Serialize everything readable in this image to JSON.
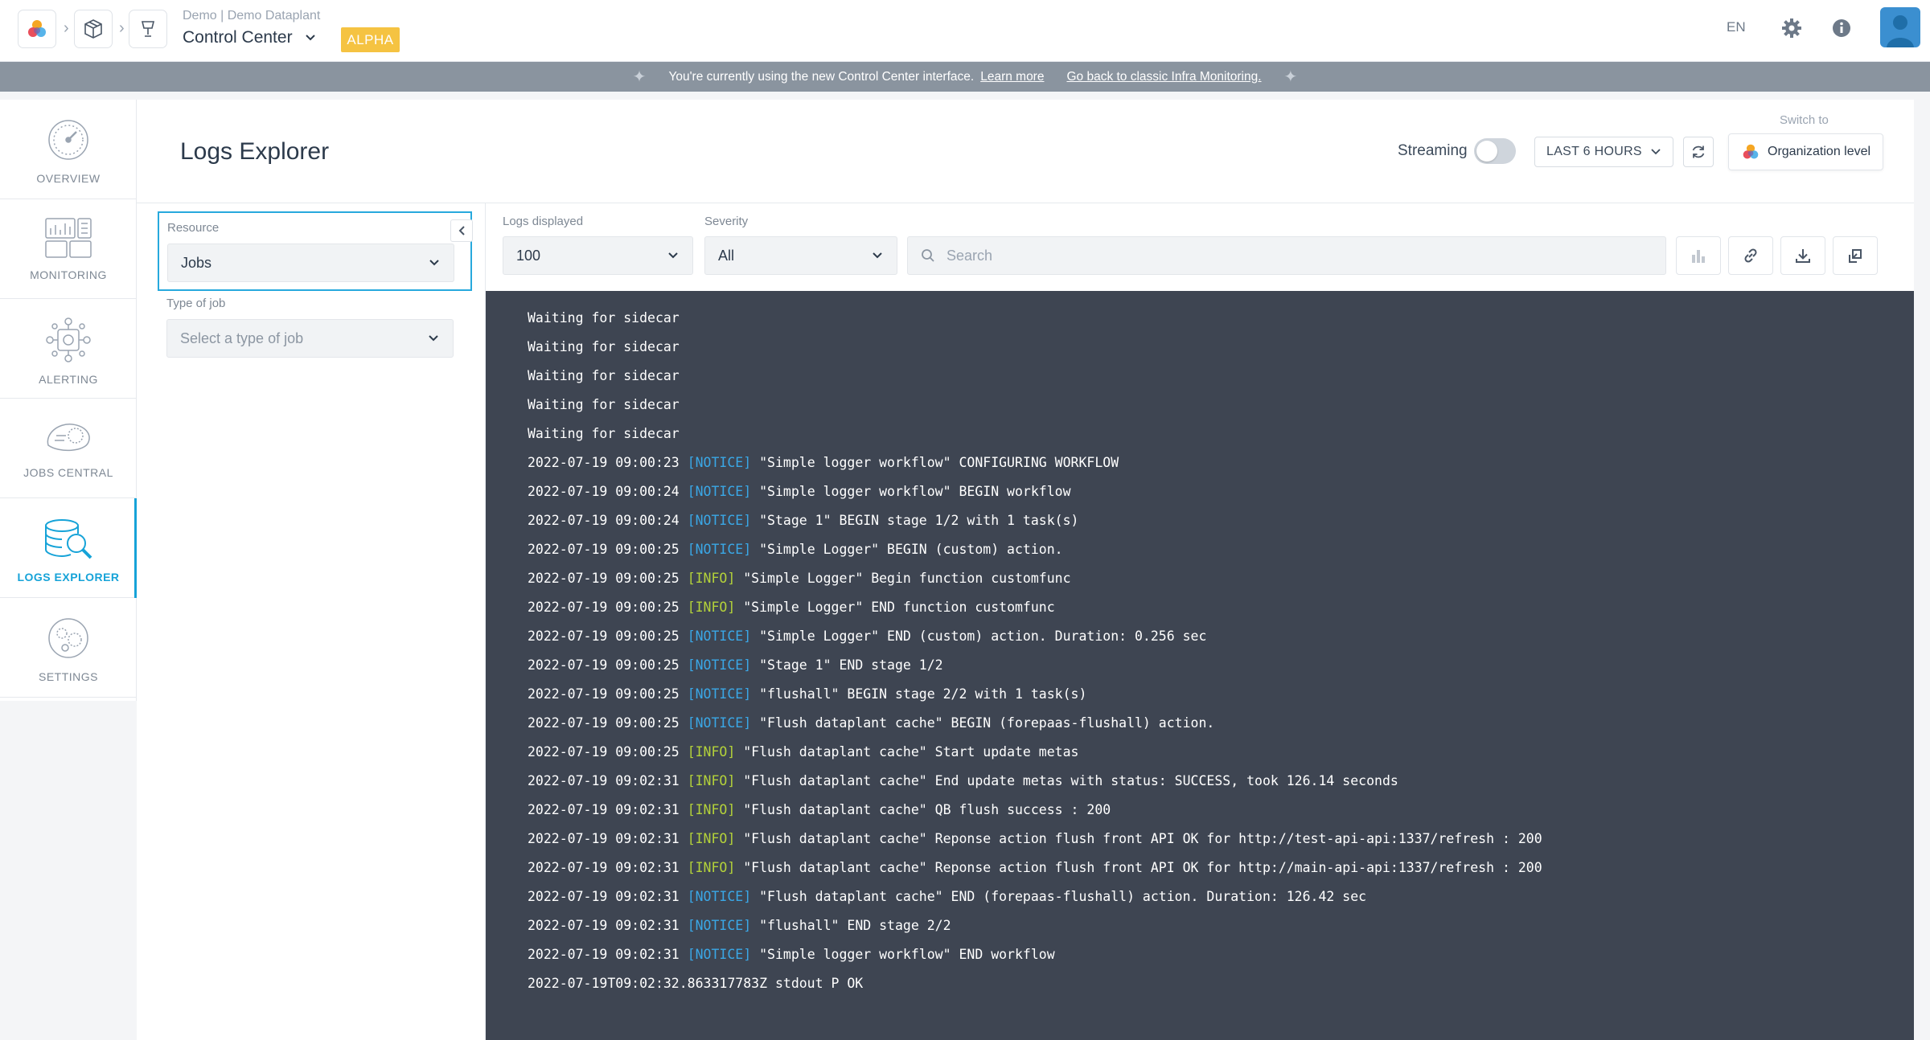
{
  "topbar": {
    "breadcrumb_sub": "Demo | Demo Dataplant",
    "project_title": "Control Center",
    "badge": "ALPHA",
    "lang": "EN"
  },
  "banner": {
    "message": "You're currently using the new Control Center interface.",
    "learn_more": "Learn more",
    "classic_link": "Go back to classic Infra Monitoring."
  },
  "nav": {
    "items": [
      {
        "label": "OVERVIEW",
        "icon": "gauge-icon"
      },
      {
        "label": "MONITORING",
        "icon": "monitoring-icon"
      },
      {
        "label": "ALERTING",
        "icon": "alerting-icon"
      },
      {
        "label": "JOBS CENTRAL",
        "icon": "jobs-icon"
      },
      {
        "label": "LOGS EXPLORER",
        "icon": "logs-search-icon",
        "active": true
      },
      {
        "label": "SETTINGS",
        "icon": "settings-icon"
      }
    ]
  },
  "header": {
    "title": "Logs Explorer",
    "streaming_label": "Streaming",
    "streaming_on": false,
    "time_range": "LAST 6 HOURS",
    "switch_to": "Switch to",
    "org_level": "Organization level"
  },
  "filters": {
    "resource_label": "Resource",
    "resource_value": "Jobs",
    "type_label": "Type of job",
    "type_placeholder": "Select a type of job"
  },
  "toolbar": {
    "logs_displayed_label": "Logs displayed",
    "logs_displayed_value": "100",
    "severity_label": "Severity",
    "severity_value": "All",
    "search_placeholder": "Search"
  },
  "colors": {
    "accent": "#16a3d8",
    "alpha_badge": "#f5c342",
    "console_bg": "#3e4552",
    "notice": "#3aa7e6",
    "info": "#b4d23a"
  },
  "logs": [
    {
      "ts": "",
      "sev": "",
      "msg": "Waiting for sidecar"
    },
    {
      "ts": "",
      "sev": "",
      "msg": "Waiting for sidecar"
    },
    {
      "ts": "",
      "sev": "",
      "msg": "Waiting for sidecar"
    },
    {
      "ts": "",
      "sev": "",
      "msg": "Waiting for sidecar"
    },
    {
      "ts": "",
      "sev": "",
      "msg": "Waiting for sidecar"
    },
    {
      "ts": "2022-07-19 09:00:23",
      "sev": "NOTICE",
      "msg": "\"Simple logger workflow\" CONFIGURING WORKFLOW"
    },
    {
      "ts": "2022-07-19 09:00:24",
      "sev": "NOTICE",
      "msg": "\"Simple logger workflow\" BEGIN workflow"
    },
    {
      "ts": "2022-07-19 09:00:24",
      "sev": "NOTICE",
      "msg": "\"Stage 1\" BEGIN stage 1/2 with 1 task(s)"
    },
    {
      "ts": "2022-07-19 09:00:25",
      "sev": "NOTICE",
      "msg": "\"Simple Logger\" BEGIN (custom) action."
    },
    {
      "ts": "2022-07-19 09:00:25",
      "sev": "INFO",
      "msg": "\"Simple Logger\" Begin function customfunc"
    },
    {
      "ts": "2022-07-19 09:00:25",
      "sev": "INFO",
      "msg": "\"Simple Logger\" END function customfunc"
    },
    {
      "ts": "2022-07-19 09:00:25",
      "sev": "NOTICE",
      "msg": "\"Simple Logger\" END (custom) action. Duration: 0.256 sec"
    },
    {
      "ts": "2022-07-19 09:00:25",
      "sev": "NOTICE",
      "msg": "\"Stage 1\" END stage 1/2"
    },
    {
      "ts": "2022-07-19 09:00:25",
      "sev": "NOTICE",
      "msg": "\"flushall\" BEGIN stage 2/2 with 1 task(s)"
    },
    {
      "ts": "2022-07-19 09:00:25",
      "sev": "NOTICE",
      "msg": "\"Flush dataplant cache\" BEGIN (forepaas-flushall) action."
    },
    {
      "ts": "2022-07-19 09:00:25",
      "sev": "INFO",
      "msg": "\"Flush dataplant cache\" Start update metas"
    },
    {
      "ts": "2022-07-19 09:02:31",
      "sev": "INFO",
      "msg": "\"Flush dataplant cache\" End update metas with status: SUCCESS, took 126.14 seconds"
    },
    {
      "ts": "2022-07-19 09:02:31",
      "sev": "INFO",
      "msg": "\"Flush dataplant cache\" QB flush success : 200"
    },
    {
      "ts": "2022-07-19 09:02:31",
      "sev": "INFO",
      "msg": "\"Flush dataplant cache\" Reponse action flush front API OK for http://test-api-api:1337/refresh : 200"
    },
    {
      "ts": "2022-07-19 09:02:31",
      "sev": "INFO",
      "msg": "\"Flush dataplant cache\" Reponse action flush front API OK for http://main-api-api:1337/refresh : 200"
    },
    {
      "ts": "2022-07-19 09:02:31",
      "sev": "NOTICE",
      "msg": "\"Flush dataplant cache\" END (forepaas-flushall) action. Duration: 126.42 sec"
    },
    {
      "ts": "2022-07-19 09:02:31",
      "sev": "NOTICE",
      "msg": "\"flushall\" END stage 2/2"
    },
    {
      "ts": "2022-07-19 09:02:31",
      "sev": "NOTICE",
      "msg": "\"Simple logger workflow\" END workflow"
    },
    {
      "ts": "",
      "sev": "",
      "msg": "2022-07-19T09:02:32.863317783Z stdout P OK"
    }
  ]
}
